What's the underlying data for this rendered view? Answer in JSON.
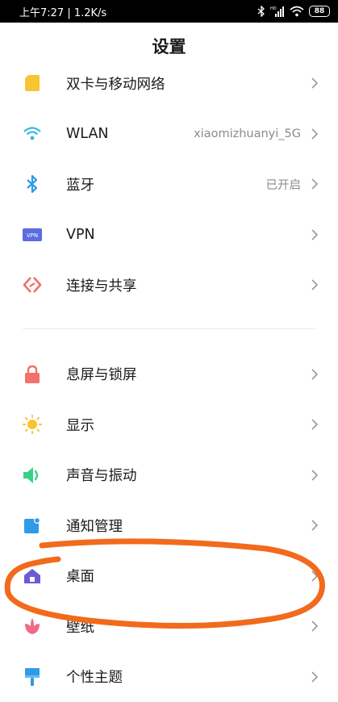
{
  "status_bar": {
    "left_text": "上午7:27 | 1.2K/s",
    "battery": "88"
  },
  "page": {
    "title": "设置"
  },
  "groups": [
    {
      "items": [
        {
          "label": "双卡与移动网络",
          "value": "",
          "icon": "sim-card-icon",
          "color": "#F7C531"
        },
        {
          "label": "WLAN",
          "value": "xiaomizhuanyi_5G",
          "icon": "wifi-icon",
          "color": "#3AB5E6"
        },
        {
          "label": "蓝牙",
          "value": "已开启",
          "icon": "bluetooth-icon",
          "color": "#2E9BE6"
        },
        {
          "label": "VPN",
          "value": "",
          "icon": "vpn-icon",
          "color": "#5B6BE0"
        },
        {
          "label": "连接与共享",
          "value": "",
          "icon": "connection-share-icon",
          "color": "#F0706A"
        }
      ]
    },
    {
      "items": [
        {
          "label": "息屏与锁屏",
          "value": "",
          "icon": "lock-icon",
          "color": "#F2716C"
        },
        {
          "label": "显示",
          "value": "",
          "icon": "sun-icon",
          "color": "#F7C531"
        },
        {
          "label": "声音与振动",
          "value": "",
          "icon": "speaker-icon",
          "color": "#3CCF8A"
        },
        {
          "label": "通知管理",
          "value": "",
          "icon": "notification-icon",
          "color": "#2E9BE6"
        },
        {
          "label": "桌面",
          "value": "",
          "icon": "home-icon",
          "color": "#6A5BD6"
        },
        {
          "label": "壁纸",
          "value": "",
          "icon": "flower-icon",
          "color": "#F06A8A"
        },
        {
          "label": "个性主题",
          "value": "",
          "icon": "brush-icon",
          "color": "#2E9BE6"
        }
      ]
    }
  ],
  "annotation": {
    "color": "#F26A1B"
  }
}
